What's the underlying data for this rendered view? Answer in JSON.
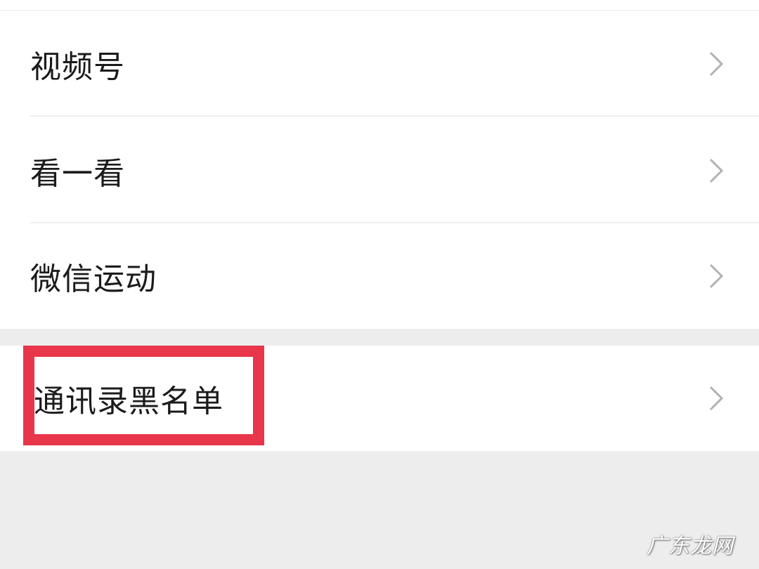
{
  "menu": {
    "items": [
      {
        "label": "视频号",
        "icon": "chevron-right-icon"
      },
      {
        "label": "看一看",
        "icon": "chevron-right-icon"
      },
      {
        "label": "微信运动",
        "icon": "chevron-right-icon"
      },
      {
        "label": "通讯录黑名单",
        "icon": "chevron-right-icon",
        "highlighted": true
      }
    ]
  },
  "watermark": {
    "text": "广东龙网"
  },
  "colors": {
    "page_background": "#ededed",
    "row_background": "#ffffff",
    "text": "#1b1b1b",
    "chevron": "#b2b2b2",
    "highlight": "#e8364a"
  }
}
